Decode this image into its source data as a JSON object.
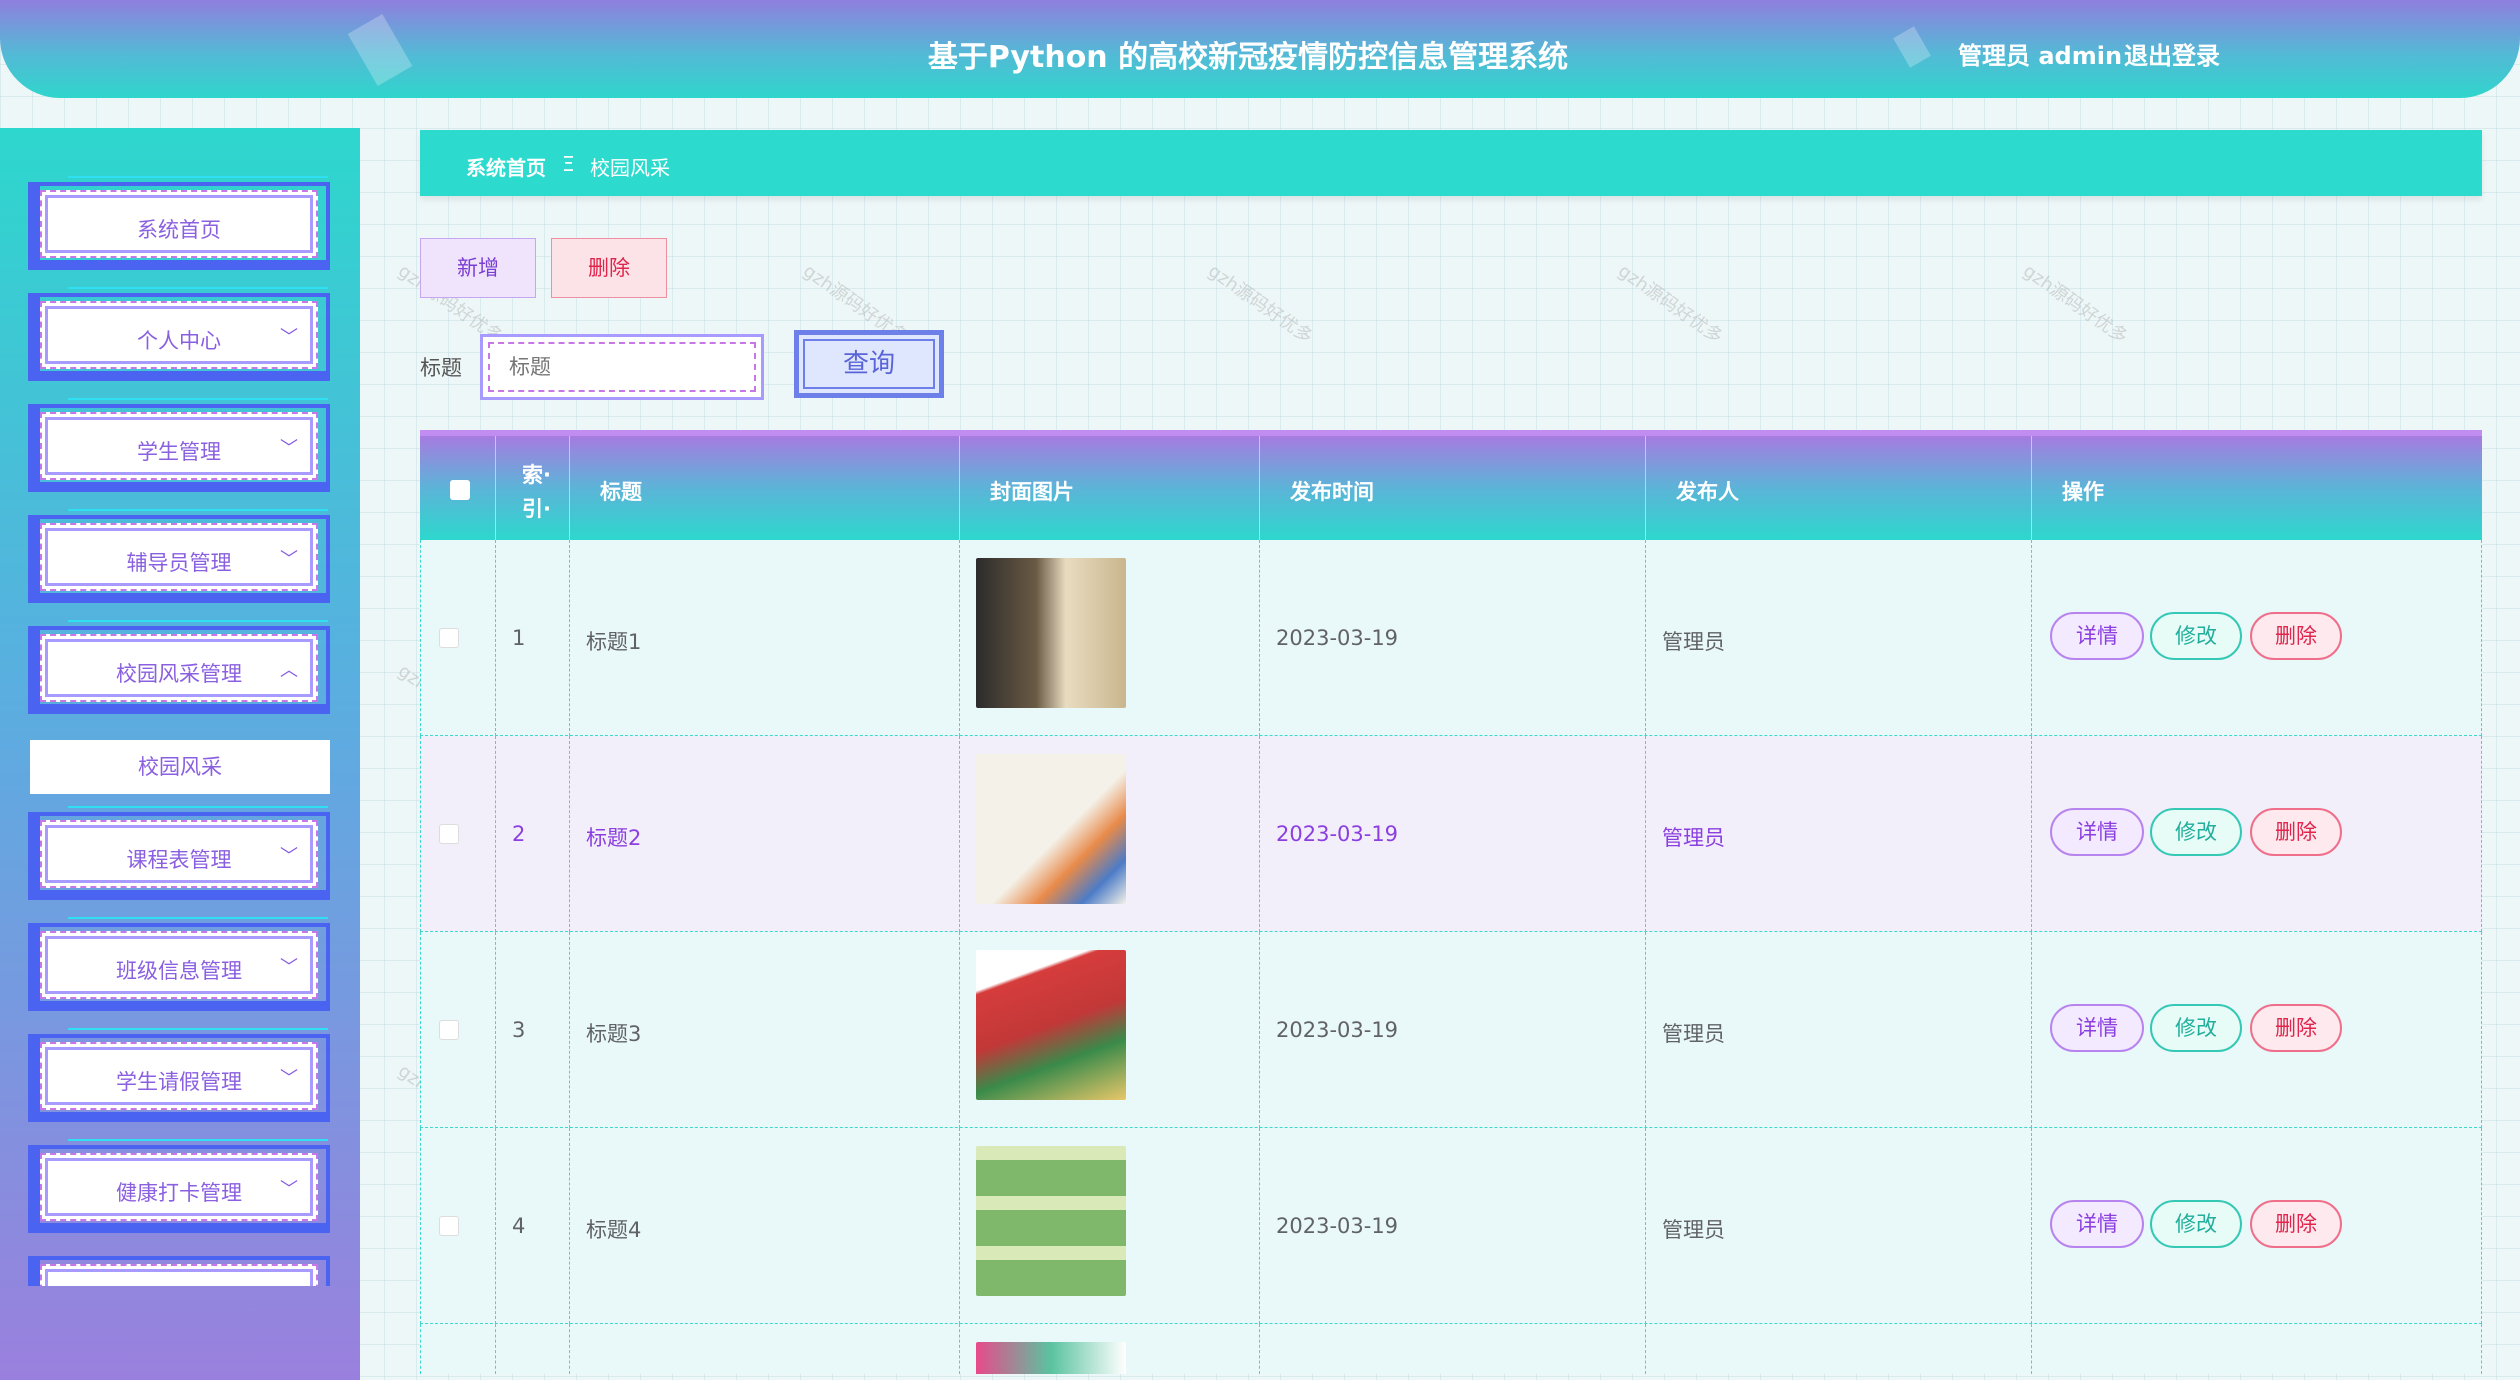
{
  "header": {
    "title": "基于Python 的高校新冠疫情防控信息管理系统",
    "user": "管理员 admin",
    "logout": "退出登录"
  },
  "sidebar": {
    "items": [
      {
        "label": "系统首页",
        "chevron": ""
      },
      {
        "label": "个人中心",
        "chevron": "﹀"
      },
      {
        "label": "学生管理",
        "chevron": "﹀"
      },
      {
        "label": "辅导员管理",
        "chevron": "﹀"
      },
      {
        "label": "校园风采管理",
        "chevron": "︿"
      },
      {
        "label": "课程表管理",
        "chevron": "﹀"
      },
      {
        "label": "班级信息管理",
        "chevron": "﹀"
      },
      {
        "label": "学生请假管理",
        "chevron": "﹀"
      },
      {
        "label": "健康打卡管理",
        "chevron": "﹀"
      }
    ],
    "sub_item": "校园风采"
  },
  "breadcrumb": {
    "home": "系统首页",
    "sep": "Ξ",
    "current": "校园风采"
  },
  "toolbar": {
    "add": "新增",
    "delete": "删除",
    "search_label": "标题",
    "search_placeholder": "标题",
    "search_button": "查询"
  },
  "table": {
    "headers": [
      "索·引·",
      "标题",
      "封面图片",
      "发布时间",
      "发布人",
      "操作"
    ],
    "rows": [
      {
        "index": "1",
        "title": "标题1",
        "time": "2023-03-19",
        "author": "管理员"
      },
      {
        "index": "2",
        "title": "标题2",
        "time": "2023-03-19",
        "author": "管理员"
      },
      {
        "index": "3",
        "title": "标题3",
        "time": "2023-03-19",
        "author": "管理员"
      },
      {
        "index": "4",
        "title": "标题4",
        "time": "2023-03-19",
        "author": "管理员"
      }
    ],
    "actions": {
      "detail": "详情",
      "edit": "修改",
      "remove": "删除"
    }
  },
  "watermark": "gzh源码好优多"
}
